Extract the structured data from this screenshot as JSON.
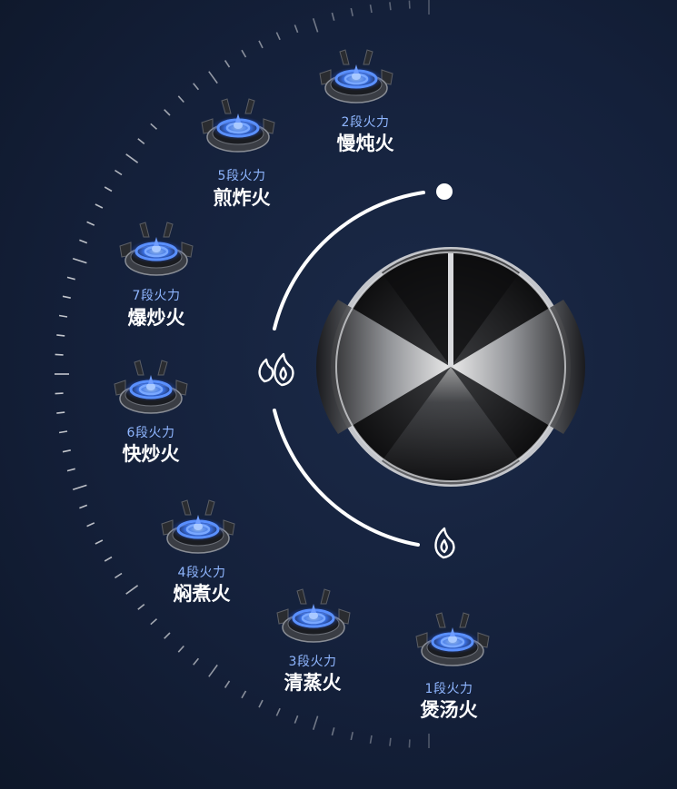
{
  "colors": {
    "background": "#14203a",
    "flame_blue": "#3f7dff",
    "level_text": "#8fb6ff",
    "mode_text": "#ffffff",
    "knob_ring": "#b9bcc2"
  },
  "knob": {
    "high_icon": "double-flame-icon",
    "low_icon": "single-flame-icon",
    "max_marker": "white-dot"
  },
  "burners": [
    {
      "level": "2段火力",
      "mode": "慢炖火"
    },
    {
      "level": "5段火力",
      "mode": "煎炸火"
    },
    {
      "level": "7段火力",
      "mode": "爆炒火"
    },
    {
      "level": "6段火力",
      "mode": "快炒火"
    },
    {
      "level": "4段火力",
      "mode": "焖煮火"
    },
    {
      "level": "3段火力",
      "mode": "清蒸火"
    },
    {
      "level": "1段火力",
      "mode": "煲汤火"
    }
  ]
}
